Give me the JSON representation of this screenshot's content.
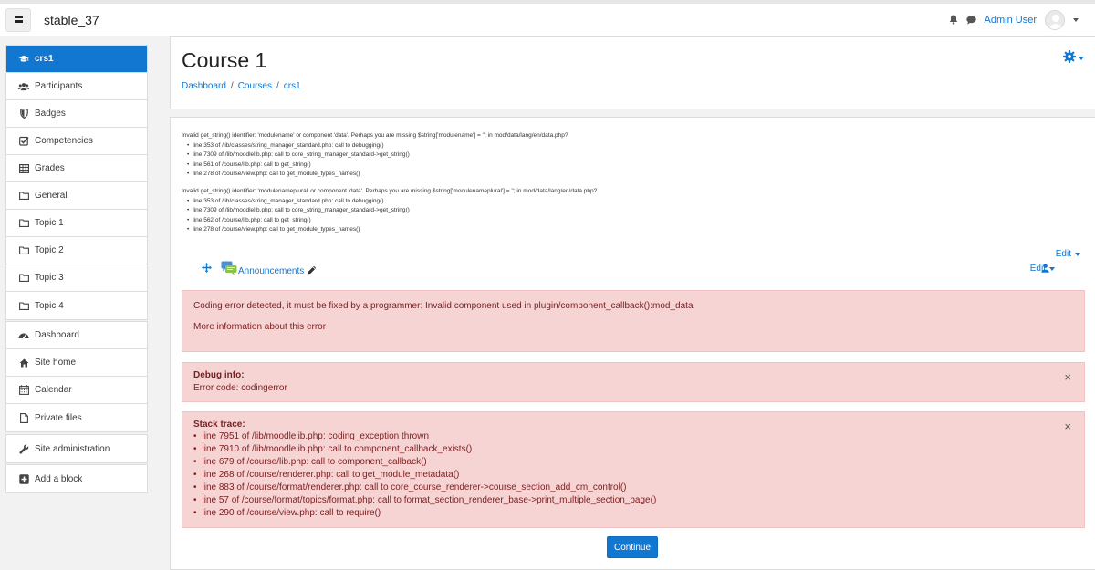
{
  "navbar": {
    "site_name": "stable_37",
    "user_name": "Admin User"
  },
  "sidebar": {
    "course_nav": [
      {
        "label": "crs1",
        "icon": "graduation-cap-icon",
        "active": true
      },
      {
        "label": "Participants",
        "icon": "users-icon"
      },
      {
        "label": "Badges",
        "icon": "shield-icon"
      },
      {
        "label": "Competencies",
        "icon": "check-square-icon"
      },
      {
        "label": "Grades",
        "icon": "table-icon"
      },
      {
        "label": "General",
        "icon": "folder-icon"
      },
      {
        "label": "Topic 1",
        "icon": "folder-icon"
      },
      {
        "label": "Topic 2",
        "icon": "folder-icon"
      },
      {
        "label": "Topic 3",
        "icon": "folder-icon"
      },
      {
        "label": "Topic 4",
        "icon": "folder-icon"
      }
    ],
    "site_nav": [
      {
        "label": "Dashboard",
        "icon": "dashboard-icon"
      },
      {
        "label": "Site home",
        "icon": "home-icon"
      },
      {
        "label": "Calendar",
        "icon": "calendar-icon"
      },
      {
        "label": "Private files",
        "icon": "file-icon"
      }
    ],
    "admin": {
      "label": "Site administration",
      "icon": "wrench-icon"
    },
    "add_block": {
      "label": "Add a block",
      "icon": "plus-square-icon"
    }
  },
  "header": {
    "title": "Course 1",
    "breadcrumb": [
      "Dashboard",
      "Courses",
      "crs1"
    ]
  },
  "debug_messages": [
    {
      "message": "Invalid get_string() identifier: 'modulename' or component 'data'. Perhaps you are missing $string['modulename'] = ''; in mod/data/lang/en/data.php?",
      "lines": [
        "line 353 of /lib/classes/string_manager_standard.php: call to debugging()",
        "line 7309 of /lib/moodlelib.php: call to core_string_manager_standard->get_string()",
        "line 561 of /course/lib.php: call to get_string()",
        "line 278 of /course/view.php: call to get_module_types_names()"
      ]
    },
    {
      "message": "Invalid get_string() identifier: 'modulenameplural' or component 'data'. Perhaps you are missing $string['modulenameplural'] = ''; in mod/data/lang/en/data.php?",
      "lines": [
        "line 353 of /lib/classes/string_manager_standard.php: call to debugging()",
        "line 7309 of /lib/moodlelib.php: call to core_string_manager_standard->get_string()",
        "line 562 of /course/lib.php: call to get_string()",
        "line 278 of /course/view.php: call to get_module_types_names()"
      ]
    }
  ],
  "section": {
    "edit_label": "Edit",
    "activity_name": "Announcements",
    "activity_edit_label": "Edit"
  },
  "error": {
    "message": "Coding error detected, it must be fixed by a programmer: Invalid component used in plugin/component_callback():mod_data",
    "more_info": "More information about this error"
  },
  "debug_info": {
    "title": "Debug info:",
    "text": "Error code: codingerror"
  },
  "stack_trace": {
    "title": "Stack trace:",
    "lines": [
      "line 7951 of /lib/moodlelib.php: coding_exception thrown",
      "line 7910 of /lib/moodlelib.php: call to component_callback_exists()",
      "line 679 of /course/lib.php: call to component_callback()",
      "line 268 of /course/renderer.php: call to get_module_metadata()",
      "line 883 of /course/format/renderer.php: call to core_course_renderer->course_section_add_cm_control()",
      "line 57 of /course/format/topics/format.php: call to format_section_renderer_base->print_multiple_section_page()",
      "line 290 of /course/view.php: call to require()"
    ]
  },
  "continue_label": "Continue",
  "close_symbol": "×",
  "colors": {
    "accent": "#1177d1",
    "alert_bg": "#f7d4d4",
    "alert_text": "#7b1e1e"
  }
}
